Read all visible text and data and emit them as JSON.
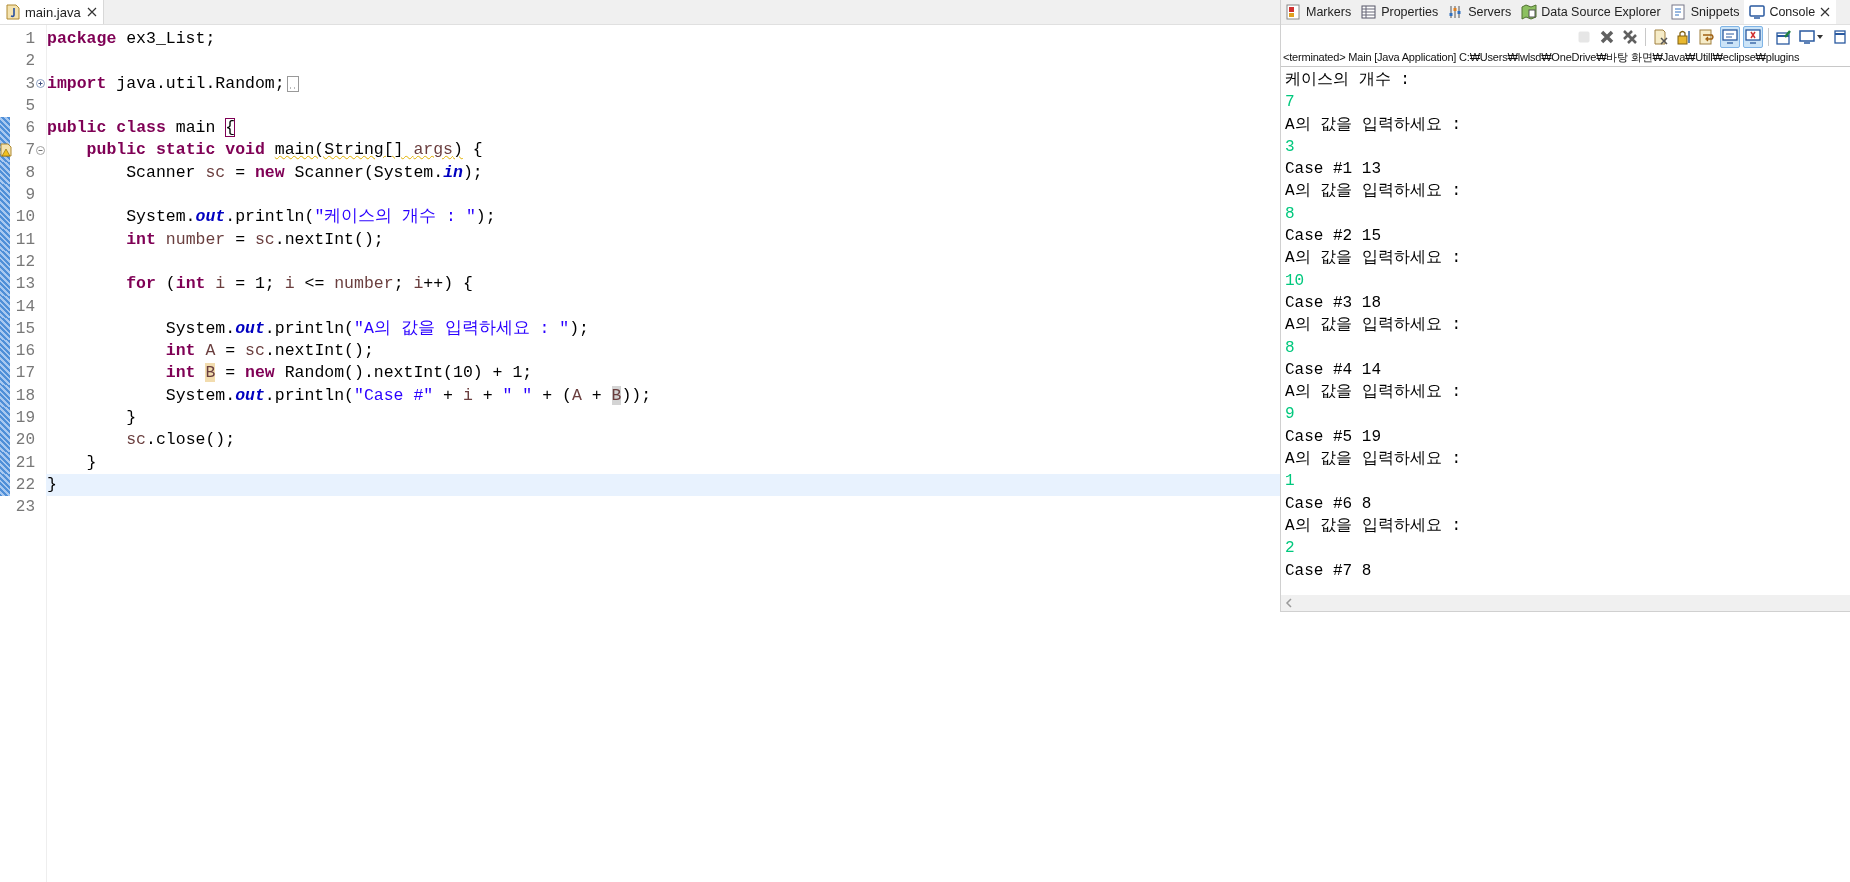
{
  "editor": {
    "tabs": [
      {
        "label": "main.java",
        "selected": true
      }
    ],
    "lines": [
      {
        "number": "1",
        "changed": false,
        "current": false,
        "tokens": [
          {
            "text": "package",
            "kind": "keyword"
          },
          {
            "text": " ex3_List;",
            "kind": "plain"
          }
        ]
      },
      {
        "number": "2",
        "changed": false,
        "current": false
      },
      {
        "number": "3",
        "changed": false,
        "current": false,
        "fold_expanded": false,
        "folded": true,
        "tokens": [
          {
            "text": "import",
            "kind": "keyword"
          },
          {
            "text": " java.util.Random;",
            "kind": "plain"
          }
        ]
      },
      {
        "number": "5",
        "changed": false,
        "current": false
      },
      {
        "number": "6",
        "changed": true,
        "current": false,
        "tokens": [
          {
            "text": "public",
            "kind": "keyword"
          },
          {
            "text": " class",
            "kind": "keyword"
          },
          {
            "text": " main ",
            "kind": "plain"
          },
          {
            "text": "{",
            "kind": "bracket-match"
          }
        ]
      },
      {
        "number": "7",
        "changed": true,
        "current": false,
        "fold_expanded": true,
        "warning": true,
        "tokens": [
          {
            "text": "    public",
            "kind": "keyword"
          },
          {
            "text": " static",
            "kind": "keyword"
          },
          {
            "text": " void ",
            "kind": "keyword"
          },
          {
            "text": "main(String[] ",
            "kind": "warning"
          },
          {
            "text": "args",
            "kind": "warning-local"
          },
          {
            "text": ")",
            "kind": "warning"
          },
          {
            "text": " {",
            "kind": "plain"
          }
        ]
      },
      {
        "number": "8",
        "changed": true,
        "current": false,
        "tokens": [
          {
            "text": "        Scanner ",
            "kind": "plain"
          },
          {
            "text": "sc",
            "kind": "local"
          },
          {
            "text": " = ",
            "kind": "plain"
          },
          {
            "text": "new",
            "kind": "keyword"
          },
          {
            "text": " Scanner(System.",
            "kind": "plain"
          },
          {
            "text": "in",
            "kind": "field"
          },
          {
            "text": ");",
            "kind": "plain"
          }
        ]
      },
      {
        "number": "9",
        "changed": true,
        "current": false
      },
      {
        "number": "10",
        "changed": true,
        "current": false,
        "tokens": [
          {
            "text": "        System.",
            "kind": "plain"
          },
          {
            "text": "out",
            "kind": "field"
          },
          {
            "text": ".println(",
            "kind": "plain"
          },
          {
            "text": "\"케이스의 개수 : \"",
            "kind": "string"
          },
          {
            "text": ");",
            "kind": "plain"
          }
        ]
      },
      {
        "number": "11",
        "changed": true,
        "current": false,
        "tokens": [
          {
            "text": "        int",
            "kind": "keyword"
          },
          {
            "text": " number",
            "kind": "local"
          },
          {
            "text": " = ",
            "kind": "plain"
          },
          {
            "text": "sc",
            "kind": "local"
          },
          {
            "text": ".nextInt();",
            "kind": "plain"
          }
        ]
      },
      {
        "number": "12",
        "changed": true,
        "current": false
      },
      {
        "number": "13",
        "changed": true,
        "current": false,
        "tokens": [
          {
            "text": "        for",
            "kind": "keyword"
          },
          {
            "text": " (",
            "kind": "plain"
          },
          {
            "text": "int",
            "kind": "keyword"
          },
          {
            "text": " i",
            "kind": "local"
          },
          {
            "text": " = 1; ",
            "kind": "plain"
          },
          {
            "text": "i",
            "kind": "local"
          },
          {
            "text": " <= ",
            "kind": "plain"
          },
          {
            "text": "number",
            "kind": "local"
          },
          {
            "text": "; ",
            "kind": "plain"
          },
          {
            "text": "i",
            "kind": "local"
          },
          {
            "text": "++) {",
            "kind": "plain"
          }
        ]
      },
      {
        "number": "14",
        "changed": true,
        "current": false
      },
      {
        "number": "15",
        "changed": true,
        "current": false,
        "tokens": [
          {
            "text": "            System.",
            "kind": "plain"
          },
          {
            "text": "out",
            "kind": "field"
          },
          {
            "text": ".println(",
            "kind": "plain"
          },
          {
            "text": "\"A의 값을 입력하세요 : \"",
            "kind": "string"
          },
          {
            "text": ");",
            "kind": "plain"
          }
        ]
      },
      {
        "number": "16",
        "changed": true,
        "current": false,
        "tokens": [
          {
            "text": "            int",
            "kind": "keyword"
          },
          {
            "text": " A",
            "kind": "local"
          },
          {
            "text": " = ",
            "kind": "plain"
          },
          {
            "text": "sc",
            "kind": "local"
          },
          {
            "text": ".nextInt();",
            "kind": "plain"
          }
        ]
      },
      {
        "number": "17",
        "changed": true,
        "current": false,
        "tokens": [
          {
            "text": "            int ",
            "kind": "keyword"
          },
          {
            "text": "B",
            "kind": "write-occurrence"
          },
          {
            "text": " = ",
            "kind": "plain"
          },
          {
            "text": "new",
            "kind": "keyword"
          },
          {
            "text": " Random().nextInt(10) + 1;",
            "kind": "plain"
          }
        ]
      },
      {
        "number": "18",
        "changed": true,
        "current": false,
        "tokens": [
          {
            "text": "            System.",
            "kind": "plain"
          },
          {
            "text": "out",
            "kind": "field"
          },
          {
            "text": ".println(",
            "kind": "plain"
          },
          {
            "text": "\"Case #\"",
            "kind": "string"
          },
          {
            "text": " + ",
            "kind": "plain"
          },
          {
            "text": "i",
            "kind": "local"
          },
          {
            "text": " + ",
            "kind": "plain"
          },
          {
            "text": "\" \"",
            "kind": "string"
          },
          {
            "text": " + (",
            "kind": "plain"
          },
          {
            "text": "A",
            "kind": "local"
          },
          {
            "text": " + ",
            "kind": "plain"
          },
          {
            "text": "B",
            "kind": "read-occurrence"
          },
          {
            "text": "));",
            "kind": "plain"
          }
        ]
      },
      {
        "number": "19",
        "changed": true,
        "current": false,
        "tokens": [
          {
            "text": "        }",
            "kind": "plain"
          }
        ]
      },
      {
        "number": "20",
        "changed": true,
        "current": false,
        "tokens": [
          {
            "text": "        sc",
            "kind": "local"
          },
          {
            "text": ".close();",
            "kind": "plain"
          }
        ]
      },
      {
        "number": "21",
        "changed": true,
        "current": false,
        "tokens": [
          {
            "text": "    }",
            "kind": "plain"
          }
        ]
      },
      {
        "number": "22",
        "changed": true,
        "current": true,
        "tokens": [
          {
            "text": "}",
            "kind": "plain"
          }
        ]
      },
      {
        "number": "23",
        "changed": false,
        "current": false
      }
    ]
  },
  "console": {
    "tabs": [
      {
        "label": "Markers",
        "kind": "markers",
        "selected": false
      },
      {
        "label": "Properties",
        "kind": "properties",
        "selected": false
      },
      {
        "label": "Servers",
        "kind": "servers",
        "selected": false
      },
      {
        "label": "Data Source Explorer",
        "kind": "datasource",
        "selected": false
      },
      {
        "label": "Snippets",
        "kind": "snippets",
        "selected": false
      },
      {
        "label": "Console",
        "kind": "console",
        "selected": true
      }
    ],
    "toolbar": [
      {
        "kind": "terminate",
        "disabled": true,
        "on": false
      },
      {
        "kind": "remove",
        "disabled": false,
        "on": false
      },
      {
        "kind": "remove-all",
        "disabled": false,
        "on": false
      },
      {
        "kind": "separator"
      },
      {
        "kind": "clear",
        "disabled": false,
        "on": false
      },
      {
        "kind": "scroll-lock",
        "disabled": false,
        "on": false
      },
      {
        "kind": "word-wrap",
        "disabled": false,
        "on": false
      },
      {
        "kind": "show-stdout",
        "disabled": false,
        "on": true
      },
      {
        "kind": "show-stderr",
        "disabled": false,
        "on": true
      },
      {
        "kind": "separator"
      },
      {
        "kind": "pin",
        "disabled": false,
        "on": false
      },
      {
        "kind": "display",
        "disabled": false,
        "on": false
      },
      {
        "kind": "open",
        "disabled": false,
        "on": false
      }
    ],
    "status": "<terminated> Main [Java Application] C:₩Users₩lwlsd₩OneDrive₩바탕 화면₩Java₩Utill₩eclipse₩plugins",
    "output": [
      {
        "text": "케이스의 개수 :",
        "kind": "output"
      },
      {
        "text": "7",
        "kind": "input"
      },
      {
        "text": "A의 값을 입력하세요 :",
        "kind": "output"
      },
      {
        "text": "3",
        "kind": "input"
      },
      {
        "text": "Case #1 13",
        "kind": "output"
      },
      {
        "text": "A의 값을 입력하세요 :",
        "kind": "output"
      },
      {
        "text": "8",
        "kind": "input"
      },
      {
        "text": "Case #2 15",
        "kind": "output"
      },
      {
        "text": "A의 값을 입력하세요 :",
        "kind": "output"
      },
      {
        "text": "10",
        "kind": "input"
      },
      {
        "text": "Case #3 18",
        "kind": "output"
      },
      {
        "text": "A의 값을 입력하세요 :",
        "kind": "output"
      },
      {
        "text": "8",
        "kind": "input"
      },
      {
        "text": "Case #4 14",
        "kind": "output"
      },
      {
        "text": "A의 값을 입력하세요 :",
        "kind": "output"
      },
      {
        "text": "9",
        "kind": "input"
      },
      {
        "text": "Case #5 19",
        "kind": "output"
      },
      {
        "text": "A의 값을 입력하세요 :",
        "kind": "output"
      },
      {
        "text": "1",
        "kind": "input"
      },
      {
        "text": "Case #6 8",
        "kind": "output"
      },
      {
        "text": "A의 값을 입력하세요 :",
        "kind": "output"
      },
      {
        "text": "2",
        "kind": "input"
      },
      {
        "text": "Case #7 8",
        "kind": "output"
      }
    ]
  }
}
